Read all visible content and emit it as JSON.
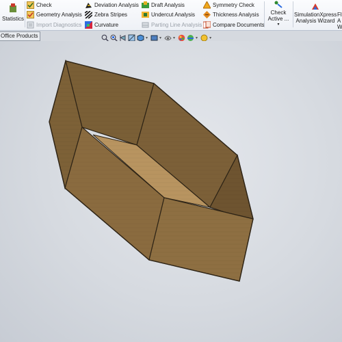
{
  "ribbon": {
    "statistics": "Statistics",
    "check": "Check",
    "geometry_analysis": "Geometry Analysis",
    "import_diagnostics": "Import Diagnostics",
    "deviation_analysis": "Deviation Analysis",
    "zebra_stripes": "Zebra Stripes",
    "curvature": "Curvature",
    "draft_analysis": "Draft Analysis",
    "undercut_analysis": "Undercut Analysis",
    "parting_line_analysis": "Parting Line Analysis",
    "symmetry_check": "Symmetry Check",
    "thickness_analysis": "Thickness Analysis",
    "compare_documents": "Compare Documents",
    "check_active_line1": "Check",
    "check_active_line2": "Active ...",
    "simxpress_line1": "SimulationXpress",
    "simxpress_line2": "Analysis Wizard",
    "fl_line1": "Fl",
    "fl_line2": "A",
    "fl_line3": "W"
  },
  "tab": {
    "label": "Office Products"
  },
  "colors": {
    "wood_dark": "#6e5530",
    "wood_mid": "#8b6c40",
    "wood_light": "#9a7a4a",
    "wood_floor": "#b5915d",
    "edge": "#2e2416",
    "viewport_bg": "#d5d9df"
  },
  "icons": [
    "statistics-icon",
    "check-icon",
    "geometry-analysis-icon",
    "import-diagnostics-icon",
    "deviation-analysis-icon",
    "zebra-stripes-icon",
    "curvature-icon",
    "draft-analysis-icon",
    "undercut-analysis-icon",
    "parting-line-analysis-icon",
    "symmetry-check-icon",
    "thickness-analysis-icon",
    "compare-documents-icon",
    "check-active-icon",
    "simulationxpress-icon"
  ]
}
